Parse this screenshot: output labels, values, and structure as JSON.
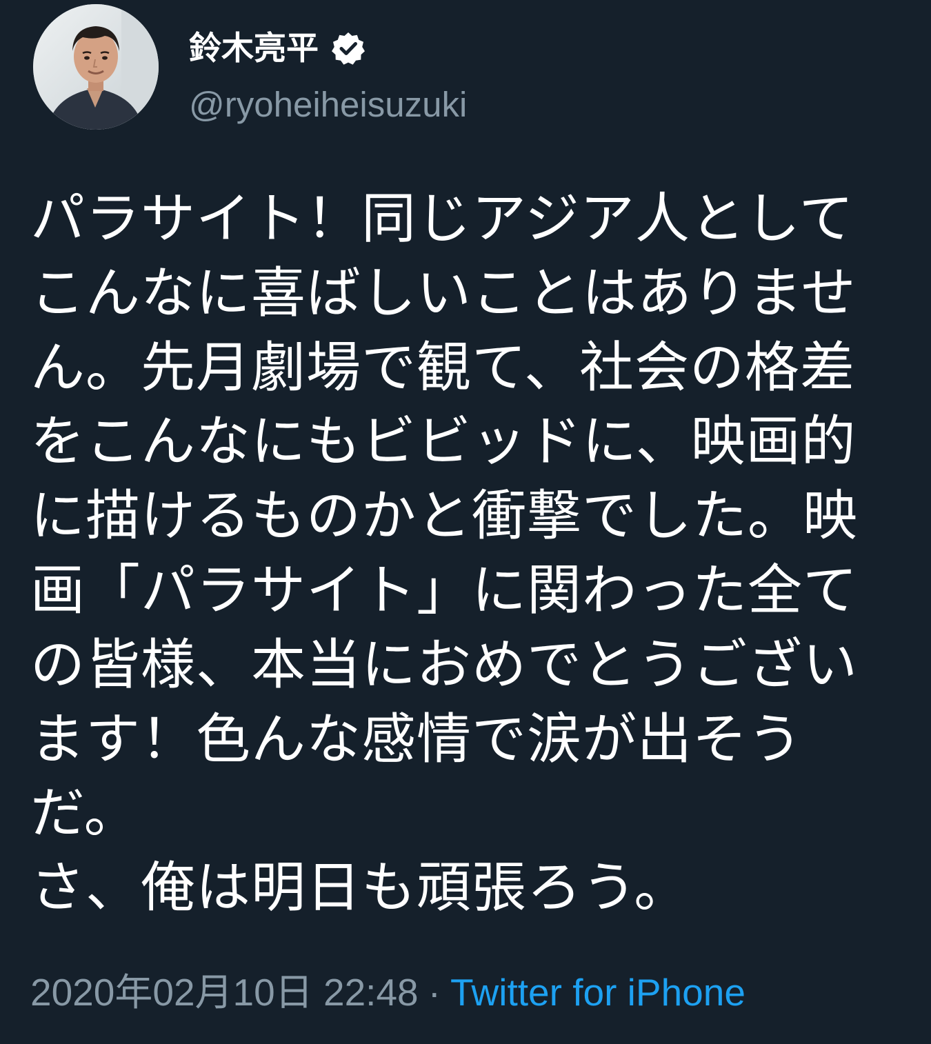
{
  "user": {
    "display_name": "鈴木亮平",
    "handle": "@ryoheiheisuzuki",
    "verified_icon": "verified-badge-icon",
    "avatar": "profile-photo"
  },
  "tweet": {
    "lines": [
      "パラサイト！同じアジア人として",
      "こんなに喜ばしいことはありませ",
      "ん。先月劇場で観て、社会の格差",
      "をこんなにもビビッドに、映画的",
      "に描けるものかと衝撃でした。映",
      "画「パラサイト」に関わった全て",
      "の皆様、本当におめでとうござい",
      "ます！色んな感情で涙が出そう",
      "だ。",
      "さ、俺は明日も頑張ろう。"
    ],
    "timestamp": "2020年02月10日 22:48",
    "separator": "·",
    "source": "Twitter for iPhone"
  },
  "colors": {
    "background": "#15202b",
    "text": "#ffffff",
    "secondary": "#8899a6",
    "link": "#1da1f2"
  }
}
